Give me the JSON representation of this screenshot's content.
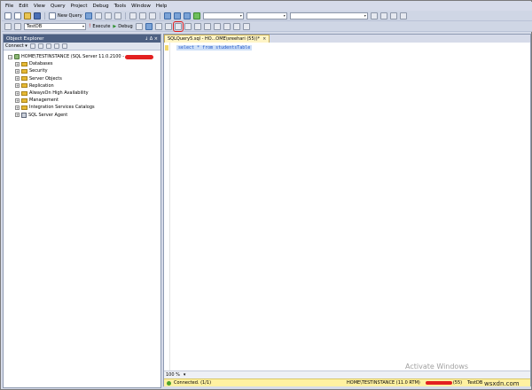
{
  "menu": [
    "File",
    "Edit",
    "View",
    "Query",
    "Project",
    "Debug",
    "Tools",
    "Window",
    "Help"
  ],
  "toolbar": {
    "new_query": "New Query",
    "database": "TestDB",
    "execute": "Execute",
    "debug": "Debug"
  },
  "object_explorer": {
    "title": "Object Explorer",
    "pin": "↓ Δ ×",
    "connect": "Connect ▾",
    "server": "HOME\\TESTINSTANCE (SQL Server 11.0.2100 -",
    "nodes": [
      "Databases",
      "Security",
      "Server Objects",
      "Replication",
      "AlwaysOn High Availability",
      "Management",
      "Integration Services Catalogs",
      "SQL Server Agent"
    ]
  },
  "editor": {
    "tab": "SQLQuery5.sql - HO...OME\\sreehari (55))*",
    "code": "select * from studentsTable",
    "zoom": "100 %"
  },
  "status": {
    "connected": "Connected. (1/1)",
    "server": "HOME\\TESTINSTANCE (11.0 RTM)",
    "session": "(55)",
    "db": "TestDB"
  },
  "watermark": "Activate Windows",
  "brand": "wsxdn.com"
}
